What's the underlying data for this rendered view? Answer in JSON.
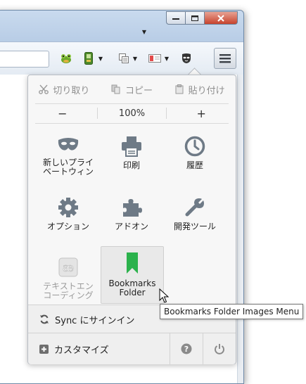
{
  "edit": {
    "cut": "切り取り",
    "copy": "コピー",
    "paste": "貼り付け"
  },
  "zoom": {
    "out": "−",
    "level": "100%",
    "in": "+"
  },
  "grid": {
    "private": "新しいプライベートウィン",
    "print": "印刷",
    "history": "履歴",
    "options": "オプション",
    "addons": "アドオン",
    "devtools": "開発ツール",
    "encoding": "テキストエンコーディング",
    "bookmarks": "Bookmarks Folder"
  },
  "footer": {
    "sync": "Sync にサインイン",
    "customize": "カスタマイズ"
  },
  "tooltip": "Bookmarks Folder Images Menu",
  "colors": {
    "icon_gray": "#6e7a86",
    "bookmark_green": "#2bb24c"
  }
}
